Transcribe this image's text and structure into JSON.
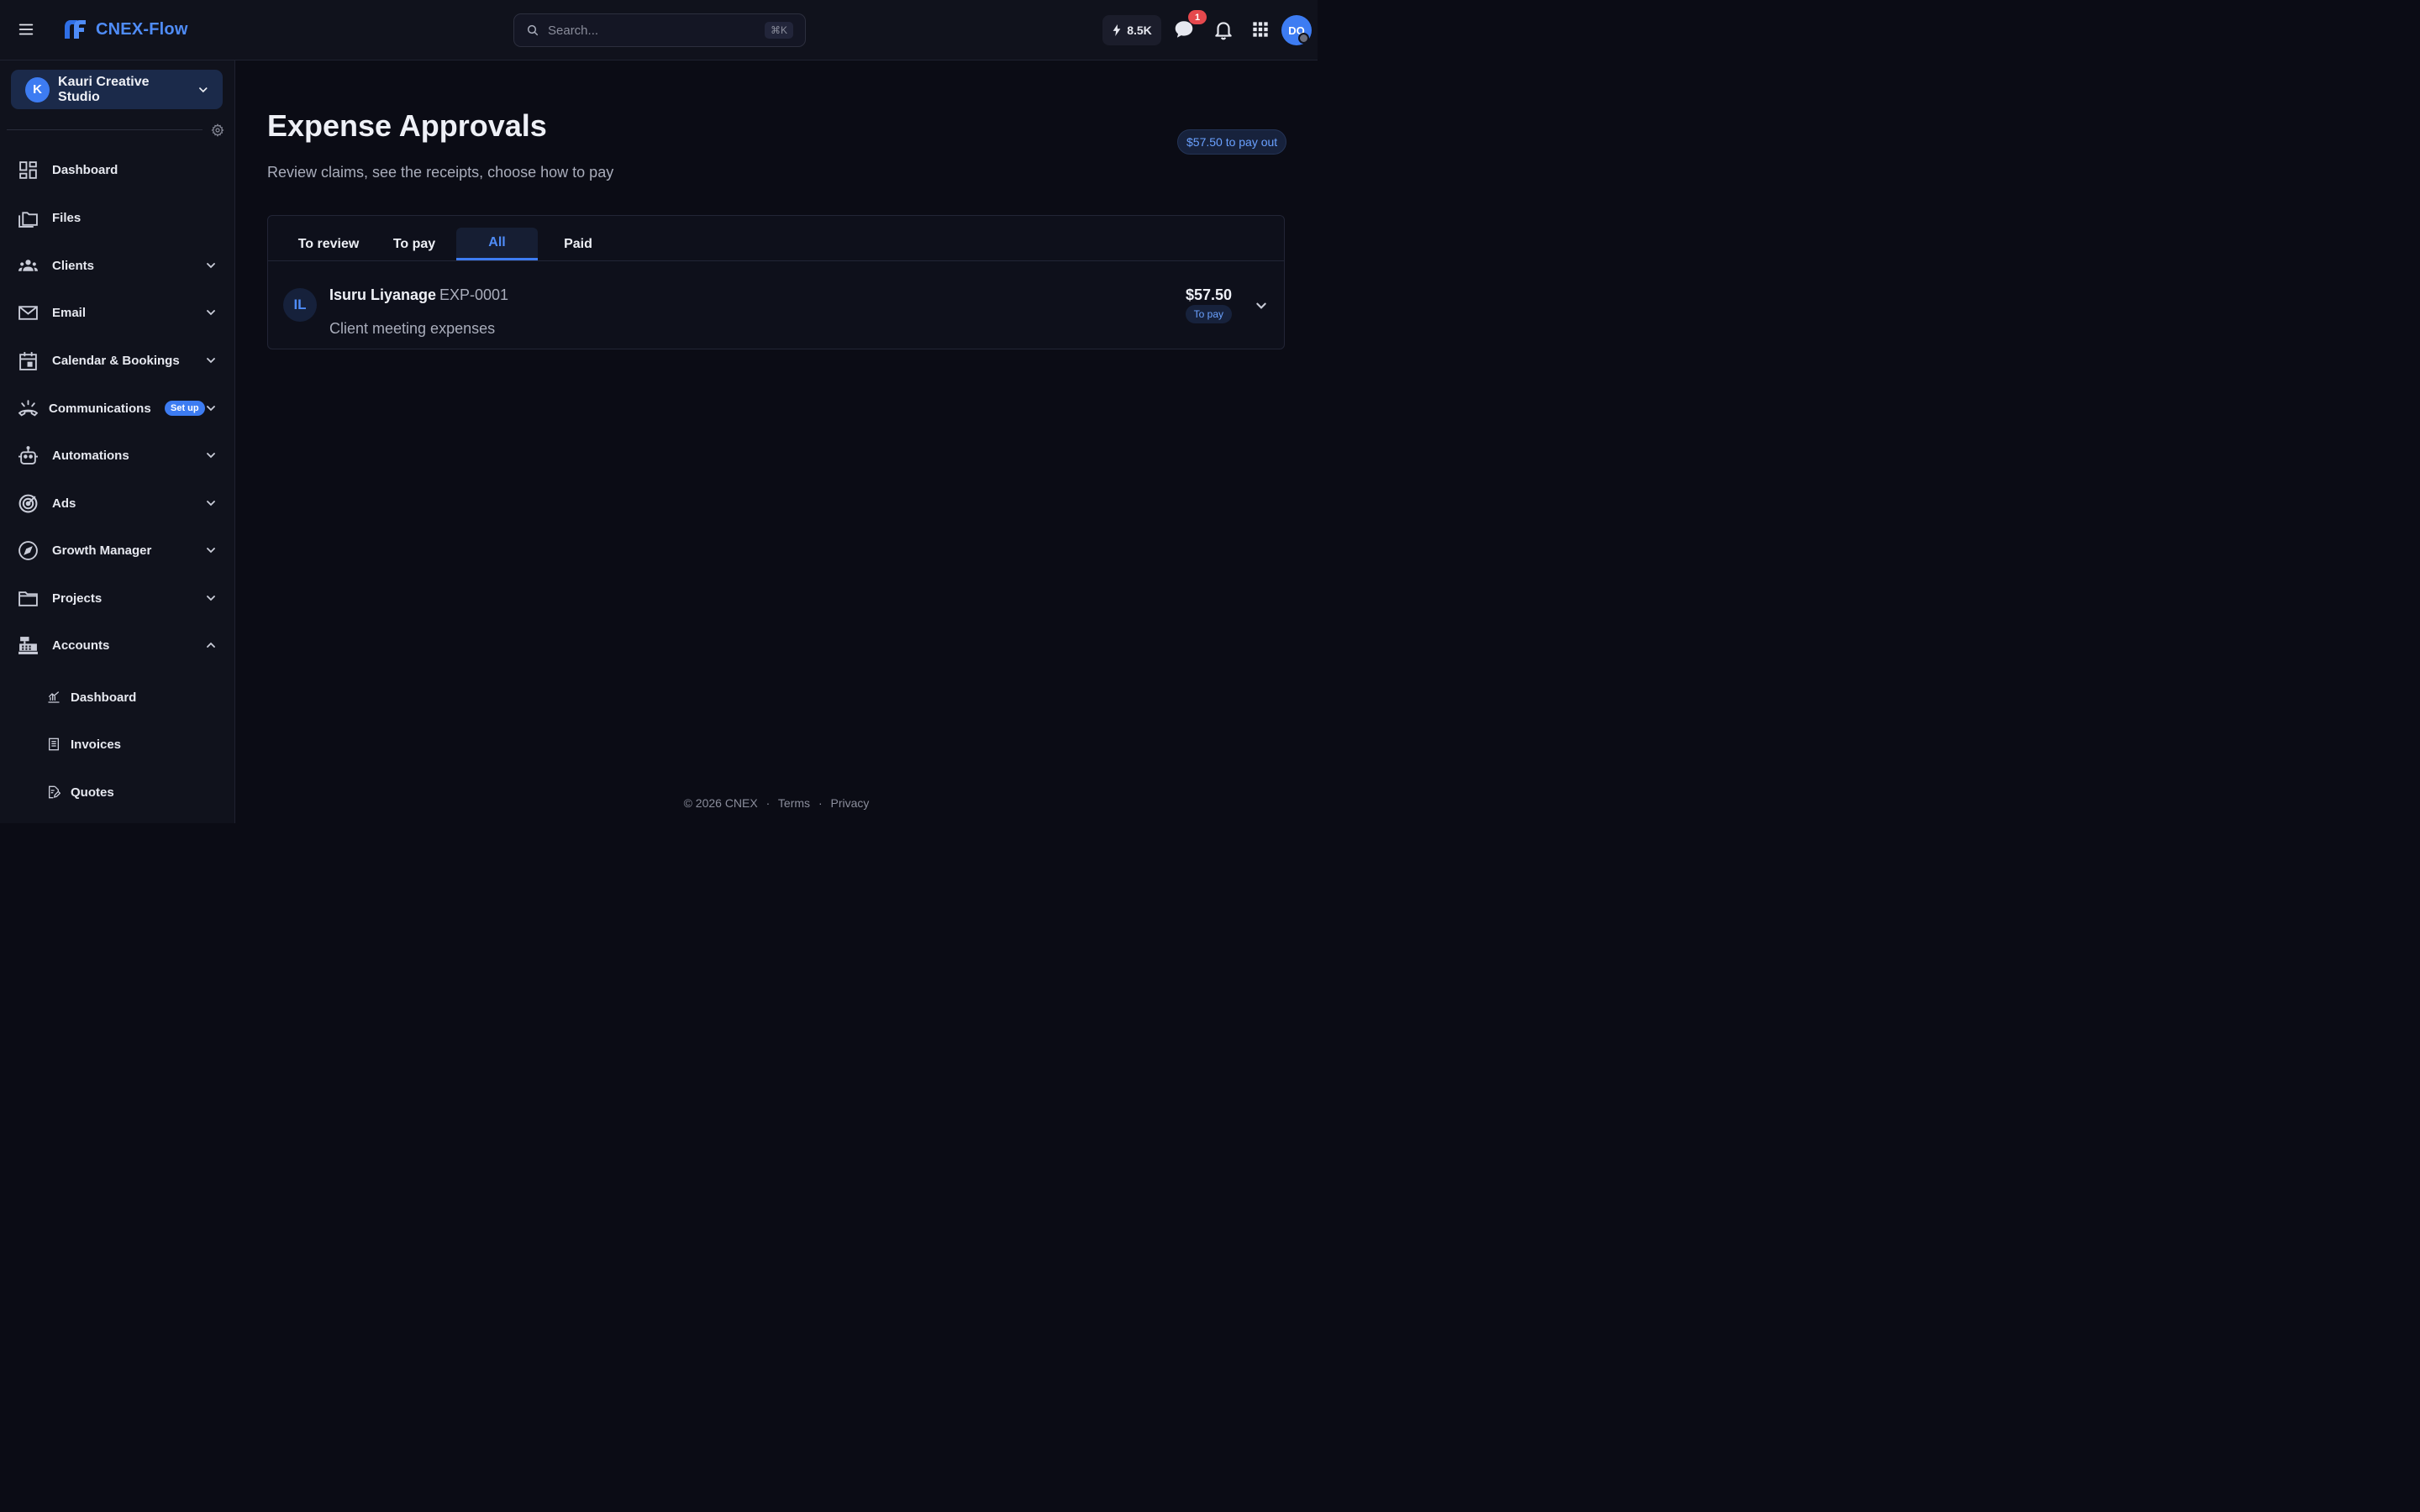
{
  "app": {
    "name": "CNEX-Flow",
    "colors": {
      "accent": "#3d7cf2",
      "background": "#0b0c15",
      "sidebar": "#10121c",
      "badge_red": "#e5484d"
    }
  },
  "topbar": {
    "search_placeholder": "Search...",
    "search_shortcut": "⌘K",
    "credits": "8.5K",
    "chat_badge": "1",
    "user_initials": "DO",
    "icons": [
      "menu-icon",
      "search-icon",
      "lightning-icon",
      "chat-icon",
      "bell-icon",
      "apps-grid-icon"
    ]
  },
  "sidebar": {
    "workspace": {
      "initial": "K",
      "name": "Kauri Creative Studio"
    },
    "items": [
      {
        "label": "Dashboard",
        "icon": "dashboard-icon"
      },
      {
        "label": "Files",
        "icon": "files-icon"
      },
      {
        "label": "Clients",
        "icon": "clients-icon"
      },
      {
        "label": "Email",
        "icon": "email-icon"
      },
      {
        "label": "Calendar & Bookings",
        "icon": "calendar-icon"
      },
      {
        "label": "Communications",
        "icon": "phone-icon",
        "badge": "Set up"
      },
      {
        "label": "Automations",
        "icon": "robot-icon"
      },
      {
        "label": "Ads",
        "icon": "target-icon"
      },
      {
        "label": "Growth Manager",
        "icon": "compass-icon"
      },
      {
        "label": "Projects",
        "icon": "folder-icon"
      },
      {
        "label": "Accounts",
        "icon": "register-icon"
      }
    ],
    "subitems": [
      {
        "label": "Dashboard",
        "icon": "chart-icon"
      },
      {
        "label": "Invoices",
        "icon": "invoice-icon"
      },
      {
        "label": "Quotes",
        "icon": "quote-icon"
      }
    ]
  },
  "main": {
    "title": "Expense Approvals",
    "subtitle": "Review claims, see the receipts, choose how to pay",
    "payout_pill": "$57.50 to pay out",
    "tabs": [
      {
        "label": "To review"
      },
      {
        "label": "To pay"
      },
      {
        "label": "All",
        "active": true
      },
      {
        "label": "Paid"
      }
    ],
    "expenses": [
      {
        "initials": "IL",
        "name": "Isuru Liyanage",
        "id": "EXP-0001",
        "description": "Client meeting expenses",
        "amount": "$57.50",
        "status": "To pay"
      }
    ]
  },
  "footer": {
    "copyright": "© 2026 CNEX",
    "sep": "·",
    "terms": "Terms",
    "privacy": "Privacy"
  }
}
